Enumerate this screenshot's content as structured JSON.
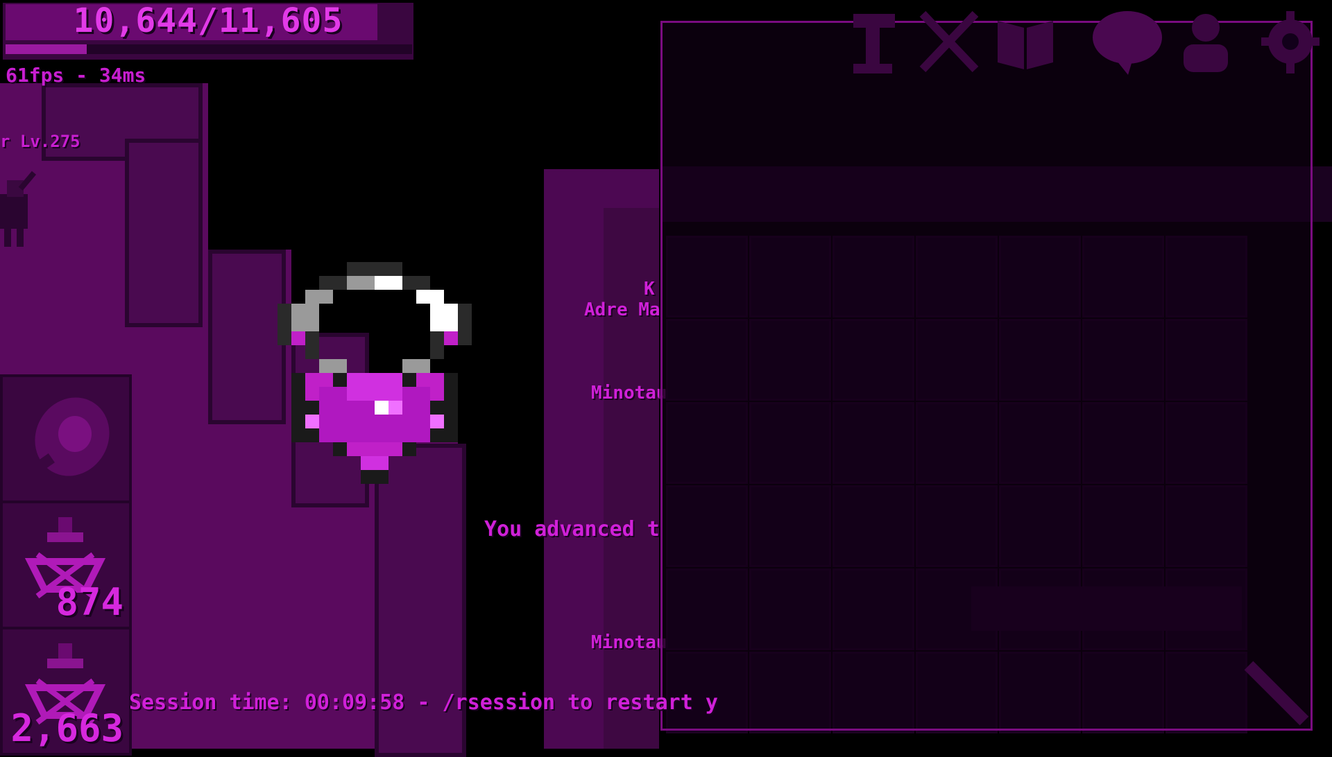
{
  "hud": {
    "hp_text": "10,644/11,605",
    "hp_fraction": 0.917,
    "xp_fraction": 0.2,
    "fps_text": "61fps - 34ms",
    "nameplate": "r Lv.275"
  },
  "slots": [
    {
      "icon": "meat-icon",
      "count": ""
    },
    {
      "icon": "potion-icon",
      "count": "874"
    },
    {
      "icon": "potion-icon",
      "count": "2,663"
    }
  ],
  "messages": {
    "advanced": "You advanced t",
    "session": "Session time: 00:09:58 - /rsession to restart y"
  },
  "side_labels": [
    "K",
    "Adre Ma",
    "Minotau",
    "Minotau"
  ],
  "toolbar": [
    "hammer-icon",
    "crossed-swords-icon",
    "book-icon",
    "chat-icon",
    "friends-icon",
    "gear-icon"
  ],
  "colors": {
    "accent": "#d020d8",
    "dark": "#1a0220"
  }
}
